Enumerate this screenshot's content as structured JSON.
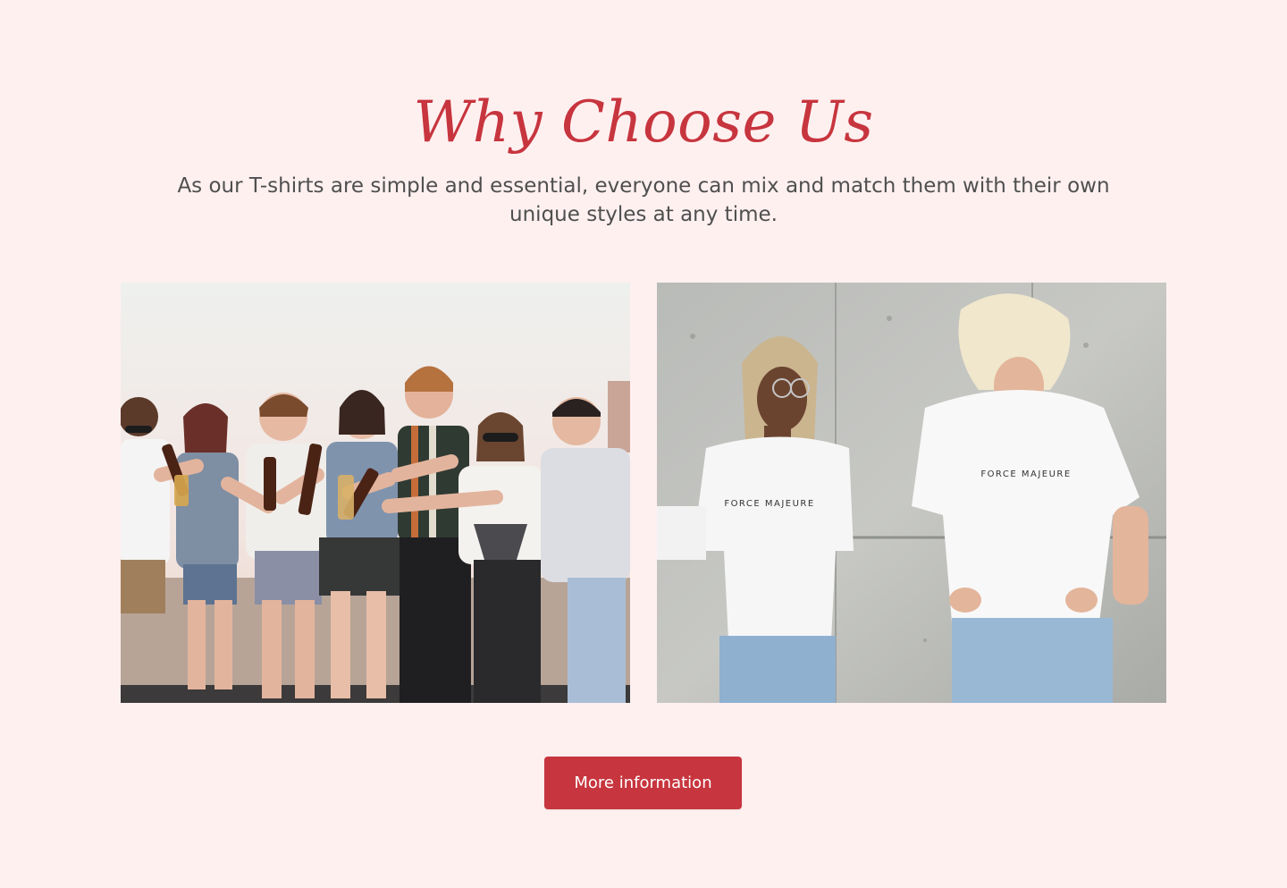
{
  "section": {
    "title": "Why Choose Us",
    "subtitle": "As our T-shirts are simple and essential, everyone can mix and match them with their own unique styles at any time.",
    "button_label": "More information"
  },
  "images": {
    "left": {
      "alt": "Group of friends toasting with drinks on a rooftop"
    },
    "right": {
      "alt": "Two people wearing white t-shirts in front of a concrete wall",
      "shirt_text_left": "FORCE MAJEURE",
      "shirt_text_right": "FORCE MAJEURE"
    }
  },
  "colors": {
    "background": "#fff0f0",
    "accent": "#c7353e",
    "text": "#4f4f4f"
  }
}
